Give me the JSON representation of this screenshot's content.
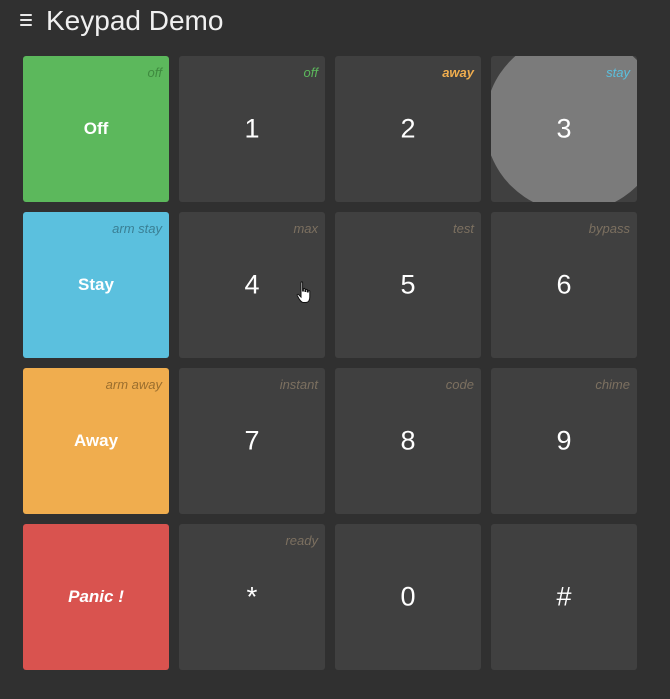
{
  "header": {
    "title": "Keypad Demo",
    "menu_icon": "hamburger-menu-icon"
  },
  "colors": {
    "background": "#303030",
    "key": "#404040",
    "off": "#5cb85c",
    "stay": "#5bc0de",
    "away": "#f0ad4e",
    "panic": "#d9534f",
    "pressed": "#7b7b7b"
  },
  "modes": [
    {
      "label": "Off",
      "hint": "off"
    },
    {
      "label": "Stay",
      "hint": "arm stay"
    },
    {
      "label": "Away",
      "hint": "arm away"
    },
    {
      "label": "Panic !",
      "hint": ""
    }
  ],
  "keys": [
    {
      "label": "1",
      "hint": "off"
    },
    {
      "label": "2",
      "hint": "away"
    },
    {
      "label": "3",
      "hint": "stay"
    },
    {
      "label": "4",
      "hint": "max"
    },
    {
      "label": "5",
      "hint": "test"
    },
    {
      "label": "6",
      "hint": "bypass"
    },
    {
      "label": "7",
      "hint": "instant"
    },
    {
      "label": "8",
      "hint": "code"
    },
    {
      "label": "9",
      "hint": "chime"
    },
    {
      "label": "*",
      "hint": "ready"
    },
    {
      "label": "0",
      "hint": ""
    },
    {
      "label": "#",
      "hint": ""
    }
  ],
  "pressed_key": "3",
  "cursor_icon": "hand-pointer-icon"
}
